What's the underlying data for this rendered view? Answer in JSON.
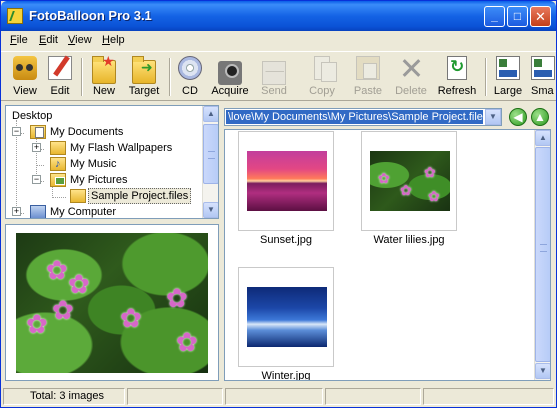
{
  "window": {
    "title": "FotoBalloon Pro 3.1",
    "controls": {
      "minimize": "_",
      "maximize": "□",
      "close": "✕"
    }
  },
  "menu": [
    {
      "label": "File",
      "accel": "F",
      "rest": "ile"
    },
    {
      "label": "Edit",
      "accel": "E",
      "rest": "dit"
    },
    {
      "label": "View",
      "accel": "V",
      "rest": "iew"
    },
    {
      "label": "Help",
      "accel": "H",
      "rest": "elp"
    }
  ],
  "toolbar": {
    "view": "View",
    "edit": "Edit",
    "new": "New",
    "target": "Target",
    "cd": "CD",
    "acquire": "Acquire",
    "send": "Send",
    "copy": "Copy",
    "paste": "Paste",
    "delete": "Delete",
    "refresh": "Refresh",
    "large": "Large",
    "small": "Sma"
  },
  "tree": {
    "items": [
      {
        "label": "Desktop",
        "icon": "desktop-icon"
      },
      {
        "label": "My Documents",
        "icon": "documents-folder-icon"
      },
      {
        "label": "My Flash Wallpapers",
        "icon": "folder-icon"
      },
      {
        "label": "My Music",
        "icon": "music-folder-icon"
      },
      {
        "label": "My Pictures",
        "icon": "pictures-folder-icon"
      },
      {
        "label": "Sample Project.files",
        "icon": "folder-open-icon"
      },
      {
        "label": "My Computer",
        "icon": "computer-icon"
      }
    ],
    "expanders": {
      "collapsed": "+",
      "expanded": "−"
    }
  },
  "path": {
    "value": "\\love\\My Documents\\My Pictures\\Sample Project.files\\"
  },
  "nav": {
    "back": "◀",
    "forward": "▲"
  },
  "thumbnails": [
    {
      "name": "Sunset.jpg",
      "kind": "sunset"
    },
    {
      "name": "Water lilies.jpg",
      "kind": "lilies"
    },
    {
      "name": "Winter.jpg",
      "kind": "winter"
    }
  ],
  "scroll_arrows": {
    "up": "▲",
    "down": "▼"
  },
  "status": {
    "total": "Total: 3 images"
  },
  "colors": {
    "titlebar": "#0A52D6",
    "selection": "#316AC5",
    "window_bg": "#ECE9D8"
  }
}
